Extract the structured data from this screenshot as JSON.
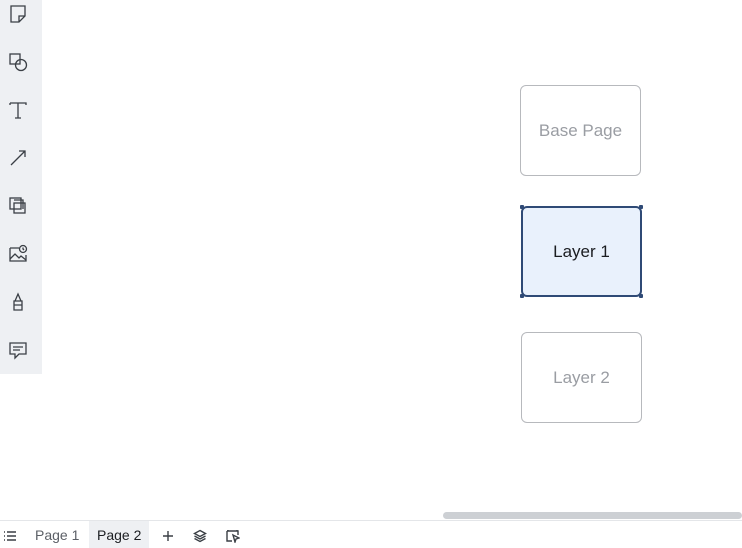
{
  "toolbar": {
    "tools": [
      {
        "name": "sticky-note-icon"
      },
      {
        "name": "shapes-icon"
      },
      {
        "name": "text-icon"
      },
      {
        "name": "arrow-icon"
      },
      {
        "name": "frame-icon"
      },
      {
        "name": "image-icon"
      },
      {
        "name": "marker-icon"
      },
      {
        "name": "comment-icon"
      }
    ]
  },
  "canvas": {
    "cards": [
      {
        "label": "Base Page",
        "selected": false
      },
      {
        "label": "Layer 1",
        "selected": true
      },
      {
        "label": "Layer 2",
        "selected": false
      }
    ]
  },
  "bottombar": {
    "tabs": [
      {
        "label": "Page 1",
        "active": false
      },
      {
        "label": "Page 2",
        "active": true
      }
    ]
  },
  "colors": {
    "accent": "#2f4a76",
    "selected_fill": "#e9f1fc",
    "toolbar_bg": "#eef0f3"
  }
}
